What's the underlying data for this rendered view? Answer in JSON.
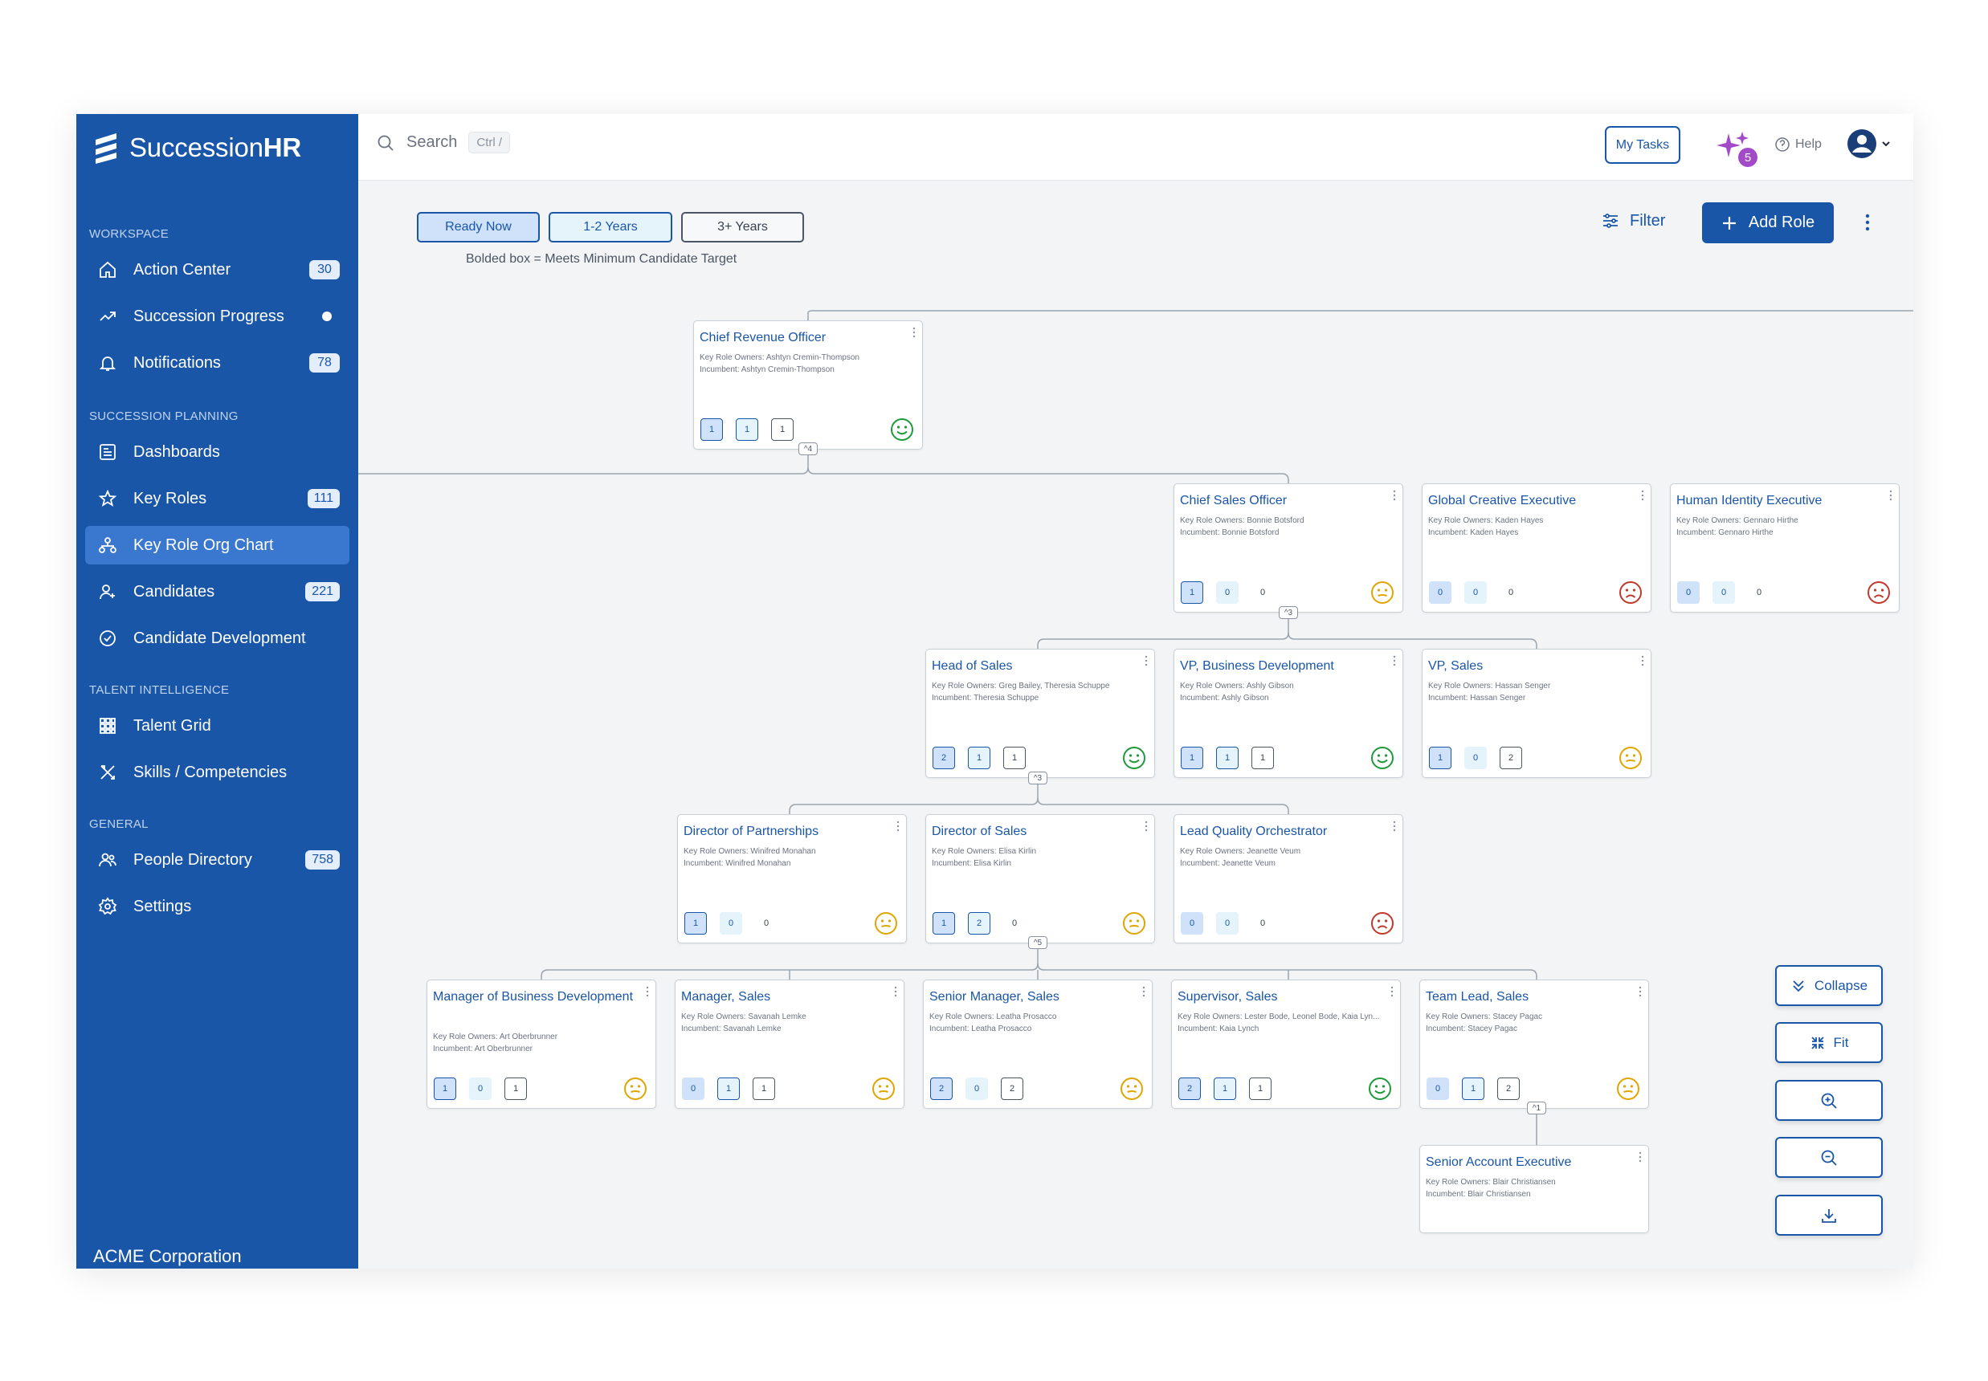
{
  "brand": {
    "name_light": "Succession",
    "name_bold": "HR"
  },
  "sidebar": {
    "sections": [
      "WORKSPACE",
      "SUCCESSION PLANNING",
      "TALENT INTELLIGENCE",
      "GENERAL"
    ],
    "items": [
      {
        "label": "Action Center",
        "count": "30"
      },
      {
        "label": "Succession Progress",
        "count": ""
      },
      {
        "label": "Notifications",
        "count": "78"
      },
      {
        "label": "Dashboards",
        "count": ""
      },
      {
        "label": "Key Roles",
        "count": "111"
      },
      {
        "label": "Key Role Org Chart",
        "count": ""
      },
      {
        "label": "Candidates",
        "count": "221"
      },
      {
        "label": "Candidate Development",
        "count": ""
      },
      {
        "label": "Talent Grid",
        "count": ""
      },
      {
        "label": "Skills / Competencies",
        "count": ""
      },
      {
        "label": "People Directory",
        "count": "758"
      },
      {
        "label": "Settings",
        "count": ""
      }
    ],
    "org": "ACME Corporation"
  },
  "topbar": {
    "search": "Search",
    "shortcut": "Ctrl /",
    "tasks": "My Tasks",
    "ai_count": "5",
    "help": "Help"
  },
  "toolbar": {
    "tabs": [
      "Ready Now",
      "1-2 Years",
      "3+ Years"
    ],
    "legend": "Bolded box = Meets Minimum Candidate Target",
    "filter": "Filter",
    "add_role": "Add Role"
  },
  "colors": {
    "brand": "#1a56a8",
    "happy": "#1f9a3a",
    "neutral": "#e0a500",
    "sad": "#c0392b"
  },
  "cards": [
    {
      "title": "Chief Revenue Officer",
      "owners": "Key Role Owners: Ashtyn Cremin-Thompson",
      "incumbent": "Incumbent: Ashtyn Cremin-Thompson",
      "pills": [
        "1",
        "1",
        "1"
      ],
      "status": "happy",
      "toggle": "^4"
    },
    {
      "title": "Chief Sales Officer",
      "owners": "Key Role Owners: Bonnie Botsford",
      "incumbent": "Incumbent: Bonnie Botsford",
      "pills": [
        "1",
        "0",
        "0"
      ],
      "status": "neutral",
      "toggle": "^3"
    },
    {
      "title": "Global Creative Executive",
      "owners": "Key Role Owners: Kaden Hayes",
      "incumbent": "Incumbent: Kaden Hayes",
      "pills": [
        "0",
        "0",
        "0"
      ],
      "status": "sad",
      "toggle": ""
    },
    {
      "title": "Human Identity Executive",
      "owners": "Key Role Owners: Gennaro Hirthe",
      "incumbent": "Incumbent: Gennaro Hirthe",
      "pills": [
        "0",
        "0",
        "0"
      ],
      "status": "sad",
      "toggle": ""
    },
    {
      "title": "Head of Sales",
      "owners": "Key Role Owners: Greg Bailey, Theresia Schuppe",
      "incumbent": "Incumbent: Theresia Schuppe",
      "pills": [
        "2",
        "1",
        "1"
      ],
      "status": "happy",
      "toggle": "^3"
    },
    {
      "title": "VP, Business Development",
      "owners": "Key Role Owners: Ashly Gibson",
      "incumbent": "Incumbent: Ashly Gibson",
      "pills": [
        "1",
        "1",
        "1"
      ],
      "status": "happy",
      "toggle": ""
    },
    {
      "title": "VP, Sales",
      "owners": "Key Role Owners: Hassan Senger",
      "incumbent": "Incumbent: Hassan Senger",
      "pills": [
        "1",
        "0",
        "2"
      ],
      "status": "neutral",
      "toggle": ""
    },
    {
      "title": "Director of Partnerships",
      "owners": "Key Role Owners: Winifred Monahan",
      "incumbent": "Incumbent: Winifred Monahan",
      "pills": [
        "1",
        "0",
        "0"
      ],
      "status": "neutral",
      "toggle": ""
    },
    {
      "title": "Director of Sales",
      "owners": "Key Role Owners: Elisa Kirlin",
      "incumbent": "Incumbent: Elisa Kirlin",
      "pills": [
        "1",
        "2",
        "0"
      ],
      "status": "neutral",
      "toggle": "^5"
    },
    {
      "title": "Lead Quality Orchestrator",
      "owners": "Key Role Owners: Jeanette Veum",
      "incumbent": "Incumbent: Jeanette Veum",
      "pills": [
        "0",
        "0",
        "0"
      ],
      "status": "sad",
      "toggle": ""
    },
    {
      "title": "Manager of Business Development",
      "owners": "Key Role Owners: Art Oberbrunner",
      "incumbent": "Incumbent: Art Oberbrunner",
      "pills": [
        "1",
        "0",
        "1"
      ],
      "status": "neutral",
      "toggle": ""
    },
    {
      "title": "Manager, Sales",
      "owners": "Key Role Owners: Savanah Lemke",
      "incumbent": "Incumbent: Savanah Lemke",
      "pills": [
        "0",
        "1",
        "1"
      ],
      "status": "neutral",
      "toggle": ""
    },
    {
      "title": "Senior Manager, Sales",
      "owners": "Key Role Owners: Leatha Prosacco",
      "incumbent": "Incumbent: Leatha Prosacco",
      "pills": [
        "2",
        "0",
        "2"
      ],
      "status": "neutral",
      "toggle": ""
    },
    {
      "title": "Supervisor, Sales",
      "owners": "Key Role Owners: Lester Bode, Leonel Bode, Kaia Lyn...",
      "incumbent": "Incumbent: Kaia Lynch",
      "pills": [
        "2",
        "1",
        "1"
      ],
      "status": "happy",
      "toggle": ""
    },
    {
      "title": "Team Lead, Sales",
      "owners": "Key Role Owners: Stacey Pagac",
      "incumbent": "Incumbent: Stacey Pagac",
      "pills": [
        "0",
        "1",
        "2"
      ],
      "status": "neutral",
      "toggle": "^1"
    },
    {
      "title": "Senior Account Executive",
      "owners": "Key Role Owners: Blair Christiansen",
      "incumbent": "Incumbent: Blair Christiansen",
      "pills": [],
      "status": "",
      "toggle": ""
    }
  ],
  "controls": {
    "collapse": "Collapse",
    "fit": "Fit"
  }
}
